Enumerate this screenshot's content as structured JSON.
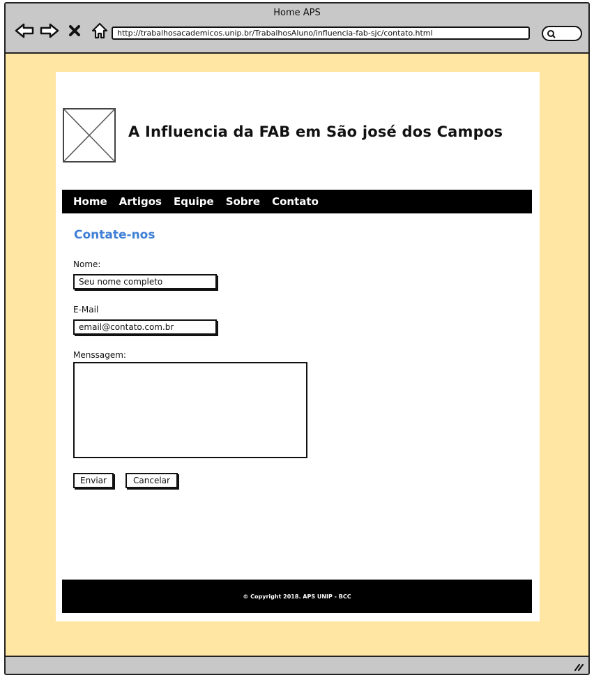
{
  "window": {
    "title": "Home APS",
    "url": "http://trabalhosacademicos.unip.br/TrabalhosAluno/influencia-fab-sjc/contato.html"
  },
  "icons": {
    "back": "arrow-left-icon",
    "forward": "arrow-right-icon",
    "stop": "close-icon",
    "home": "home-icon",
    "search": "search-icon",
    "resize": "resize-grip-icon"
  },
  "header": {
    "site_title": "A Influencia da FAB em São josé dos Campos"
  },
  "nav": {
    "items": [
      "Home",
      "Artigos",
      "Equipe",
      "Sobre",
      "Contato"
    ]
  },
  "contact": {
    "title": "Contate-nos",
    "name_label": "Nome:",
    "name_value": "Seu  nome completo",
    "email_label": "E-Mail",
    "email_value": "email@contato.com.br",
    "message_label": "Menssagem:",
    "send_label": "Enviar",
    "cancel_label": "Cancelar"
  },
  "footer": {
    "copyright": "© Copyright 2018. APS UNIP - BCC"
  },
  "colors": {
    "window_bg": "#ffe6a3",
    "chrome": "#c8c8c8",
    "accent_title": "#3f7fd6",
    "bar": "#000000"
  }
}
